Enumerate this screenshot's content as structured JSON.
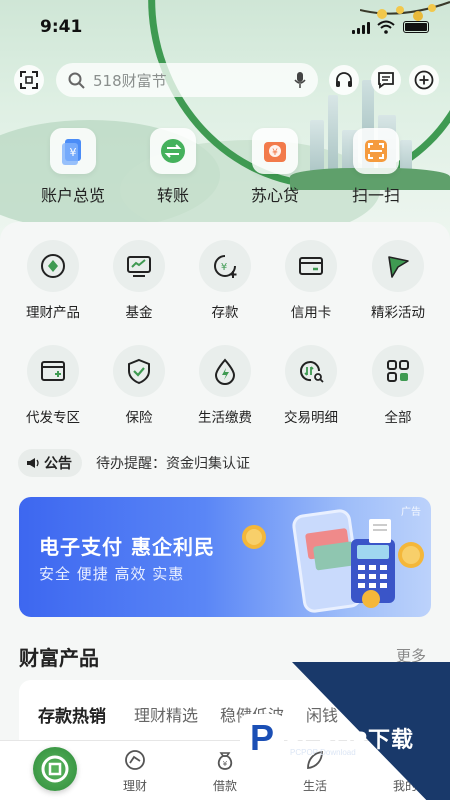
{
  "status_bar": {
    "time": "9:41"
  },
  "search": {
    "placeholder": "518财富节"
  },
  "quick_actions": [
    {
      "label": "账户总览",
      "icon": "account-overview-icon"
    },
    {
      "label": "转账",
      "icon": "transfer-icon"
    },
    {
      "label": "苏心贷",
      "icon": "loan-icon"
    },
    {
      "label": "扫一扫",
      "icon": "scan-icon"
    }
  ],
  "services": [
    {
      "label": "理财产品",
      "icon": "diamond-icon"
    },
    {
      "label": "基金",
      "icon": "fund-chart-icon"
    },
    {
      "label": "存款",
      "icon": "deposit-icon"
    },
    {
      "label": "信用卡",
      "icon": "credit-card-icon"
    },
    {
      "label": "精彩活动",
      "icon": "flag-icon"
    },
    {
      "label": "代发专区",
      "icon": "payroll-icon"
    },
    {
      "label": "保险",
      "icon": "shield-icon"
    },
    {
      "label": "生活缴费",
      "icon": "drop-bolt-icon"
    },
    {
      "label": "交易明细",
      "icon": "transaction-search-icon"
    },
    {
      "label": "全部",
      "icon": "grid-icon"
    }
  ],
  "notice": {
    "badge": "公告",
    "text": "待办提醒：资金归集认证"
  },
  "banner": {
    "title": "电子支付 惠企利民",
    "subtitle": "安全 便捷 高效 实惠",
    "ad_tag": "广告"
  },
  "wealth": {
    "title": "财富产品",
    "more": "更多",
    "tabs": [
      "存款热销",
      "理财精选",
      "稳健低波",
      "闲钱"
    ]
  },
  "bottom_nav": [
    {
      "label": "",
      "icon": "home-coin-icon"
    },
    {
      "label": "理财",
      "icon": "wealth-icon"
    },
    {
      "label": "借款",
      "icon": "loan-bag-icon"
    },
    {
      "label": "生活",
      "icon": "life-icon"
    },
    {
      "label": "我的",
      "icon": "profile-icon"
    }
  ],
  "watermark": {
    "brand": "PCPOP下载",
    "sub": "PCPOP Download",
    "logo_letter": "P"
  },
  "colors": {
    "brand_green": "#2f8c3b",
    "banner_blue": "#3d67f0",
    "watermark_navy": "#19396a"
  }
}
